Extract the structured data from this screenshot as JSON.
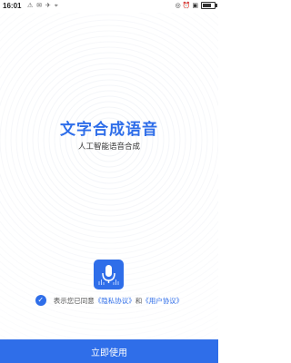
{
  "status_bar": {
    "time": "16:01",
    "left_icons": "⚠ ✉ ✈ ⌖",
    "right_icons": "◎ ⏰ ▣",
    "battery_level": 0.75
  },
  "app": {
    "title": "文字合成语音",
    "subtitle": "人工智能语音合成"
  },
  "agreement": {
    "prefix": "表示您已同意",
    "privacy_link": "《隐私协议》",
    "and": "和",
    "user_link": "《用户协议》",
    "checked": true
  },
  "start_button": {
    "label": "立即使用"
  },
  "colors": {
    "accent": "#2f6ee9",
    "background": "#ffffff"
  },
  "icons": {
    "logo": "microphone-icon",
    "check": "checkmark-icon"
  }
}
